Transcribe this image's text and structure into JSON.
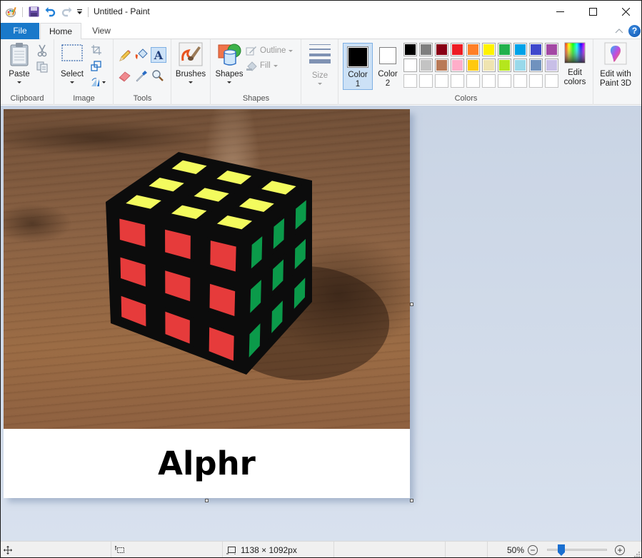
{
  "window": {
    "title": "Untitled - Paint",
    "controls": {
      "minimize": "minimize",
      "maximize": "maximize",
      "close": "close"
    }
  },
  "quick_access": {
    "icons": [
      "paint-app-icon",
      "save-icon",
      "undo-icon",
      "redo-icon",
      "customize-dropdown-icon"
    ]
  },
  "tabs": [
    {
      "label": "File",
      "active": false
    },
    {
      "label": "Home",
      "active": true
    },
    {
      "label": "View",
      "active": false
    }
  ],
  "ribbon": {
    "clipboard": {
      "label": "Clipboard",
      "paste": "Paste"
    },
    "image": {
      "label": "Image",
      "select": "Select"
    },
    "tools": {
      "label": "Tools",
      "text_tool_selected": true
    },
    "brushes": {
      "label": "Brushes"
    },
    "shapes": {
      "label": "Shapes",
      "shapes_button": "Shapes",
      "outline": "Outline",
      "fill": "Fill"
    },
    "size": {
      "label": "Size"
    },
    "colors": {
      "label": "Colors",
      "color1_line1": "Color",
      "color1_line2": "1",
      "color2_line1": "Color",
      "color2_line2": "2",
      "color1_value": "#000000",
      "color2_value": "#ffffff",
      "palette_row1": [
        "#000000",
        "#7f7f7f",
        "#880015",
        "#ed1c24",
        "#ff7f27",
        "#fff200",
        "#22b14c",
        "#00a2e8",
        "#3f48cc",
        "#a349a4"
      ],
      "palette_row2": [
        "#ffffff",
        "#c3c3c3",
        "#b97a57",
        "#ffaec9",
        "#ffc90e",
        "#efe4b0",
        "#b5e61d",
        "#99d9ea",
        "#7092be",
        "#c8bfe7"
      ],
      "palette_row3": [
        "",
        "",
        "",
        "",
        "",
        "",
        "",
        "",
        "",
        ""
      ],
      "edit_colors_line1": "Edit",
      "edit_colors_line2": "colors"
    },
    "paint3d": {
      "line1": "Edit with",
      "line2": "Paint 3D"
    }
  },
  "canvas": {
    "image_description": "Photo of a solved 3x3 Rubik's cube on a wooden table",
    "cube_faces": {
      "top": "#f3fb5e",
      "front": "#e63b3b",
      "right": "#0b9a4a"
    },
    "caption_text": "Alphr"
  },
  "statusbar": {
    "dimensions": "1138 × 1092px",
    "zoom_level": "50%",
    "zoom_percent": 50
  }
}
